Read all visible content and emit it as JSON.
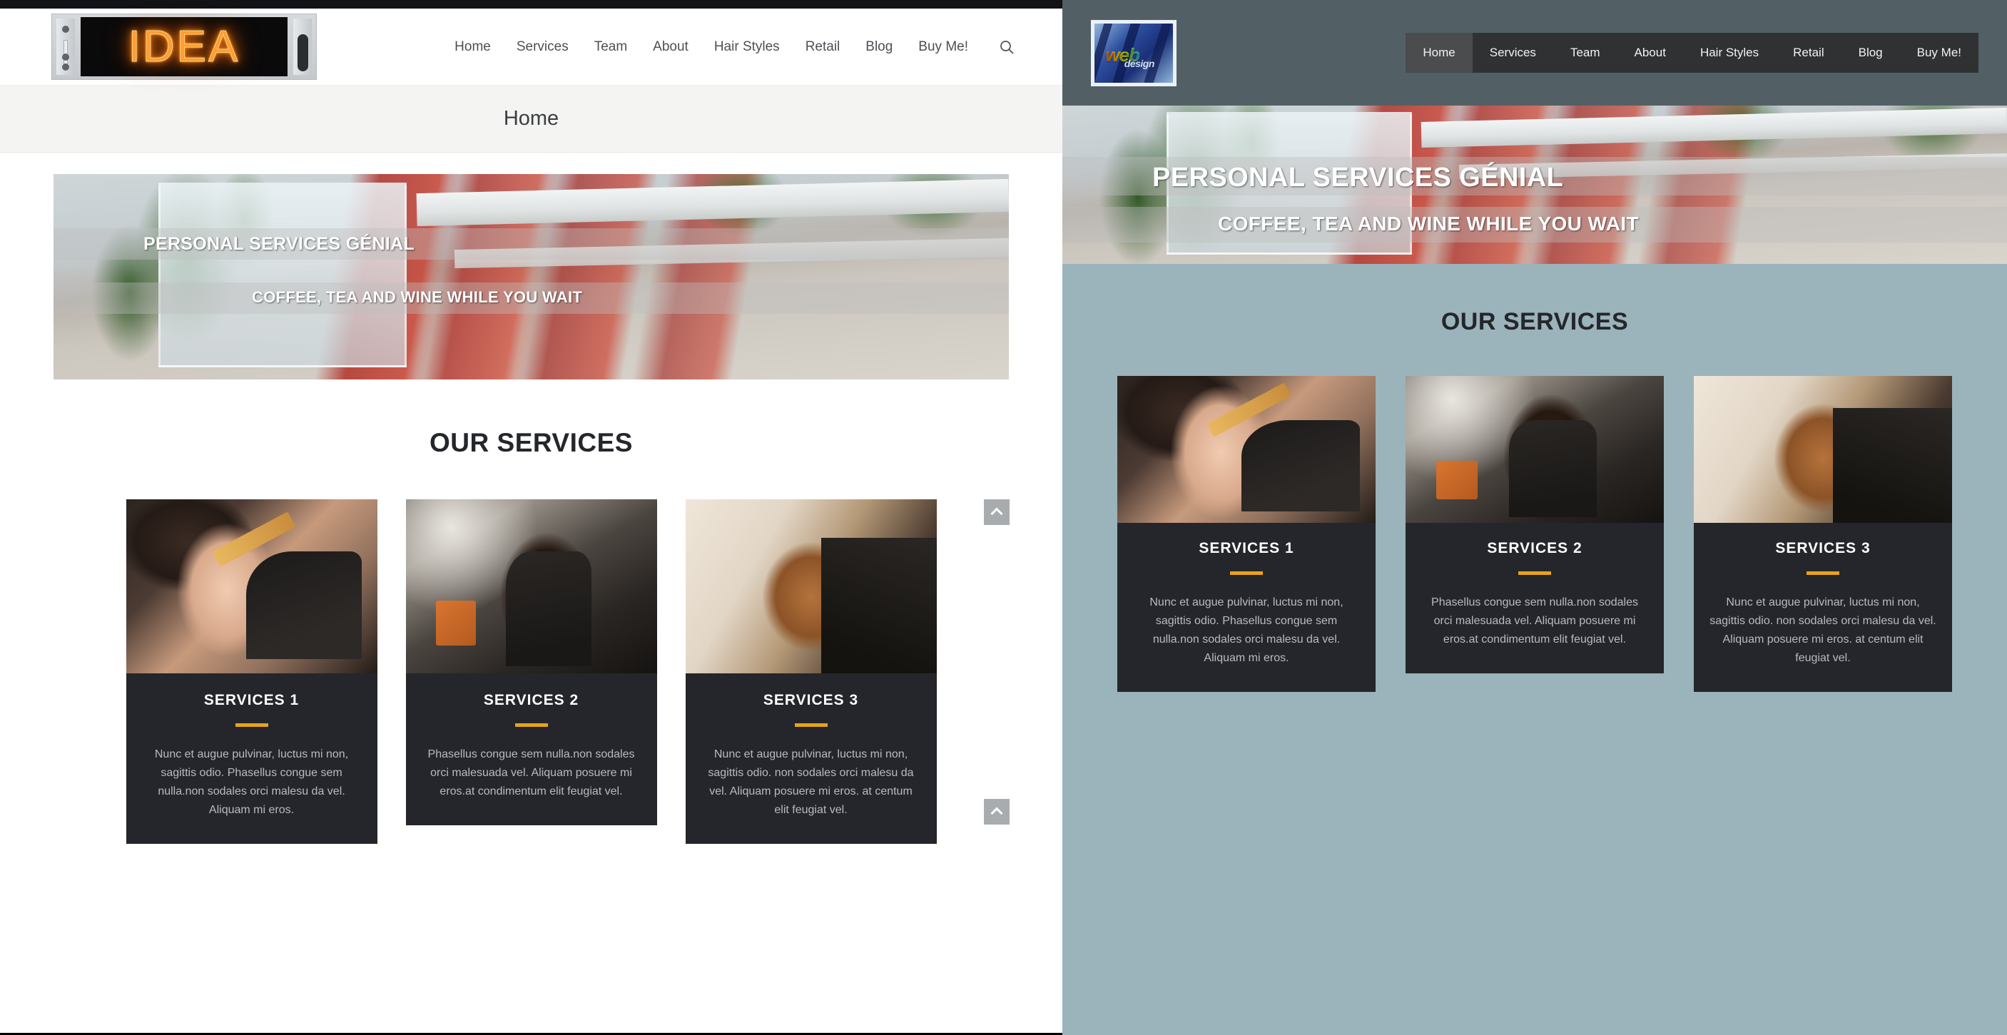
{
  "left_preview": {
    "top_strip_color": "#111317",
    "logo": {
      "name": "idea-neon-sign",
      "text": "IDEA",
      "glow_color": "#ff8a1a"
    },
    "nav": {
      "items": [
        {
          "label": "Home"
        },
        {
          "label": "Services"
        },
        {
          "label": "Team"
        },
        {
          "label": "About"
        },
        {
          "label": "Hair Styles"
        },
        {
          "label": "Retail"
        },
        {
          "label": "Blog"
        },
        {
          "label": "Buy Me!"
        }
      ],
      "search_icon": "search-icon"
    },
    "breadcrumb": {
      "text": "Home"
    },
    "hero": {
      "title": "PERSONAL SERVICES GÉNIAL",
      "subtitle": "COFFEE, TEA AND WINE WHILE YOU WAIT",
      "image_alt": "salon-interior-red-chairs"
    },
    "section": {
      "title": "OUR SERVICES"
    },
    "cards": [
      {
        "title": "SERVICES 1",
        "text": "Nunc et augue pulvinar, luctus mi non, sagittis odio. Phasellus congue sem nulla.non sodales orci malesu da vel. Aliquam mi eros.",
        "image_alt": "hairdresser-detail-braid"
      },
      {
        "title": "SERVICES 2",
        "text": "Phasellus congue sem nulla.non sodales orci malesuada vel. Aliquam posuere mi eros.at condimentum elit feugiat vel.",
        "image_alt": "stylist-blow-drying-hair"
      },
      {
        "title": "SERVICES 3",
        "text": "Nunc et augue pulvinar, luctus mi non, sagittis odio. non sodales orci malesu da vel. Aliquam posuere mi eros. at centum elit feugiat vel.",
        "image_alt": "updo-hairstyle-back-view"
      }
    ],
    "accent_color": "#e8a317",
    "card_bg_color": "#24262b",
    "scroll_top_buttons": [
      {
        "icon": "chevron-up-icon"
      },
      {
        "icon": "chevron-up-icon"
      }
    ]
  },
  "right_preview": {
    "header_bg_color": "#526065",
    "page_bg_color": "#9bb3bb",
    "logo": {
      "name": "web-design-logo",
      "text": "web",
      "subtext": "design"
    },
    "nav": {
      "bar_bg_color": "#2f3133",
      "active_bg_color": "#4a4c4e",
      "items": [
        {
          "label": "Home",
          "active": true
        },
        {
          "label": "Services",
          "active": false
        },
        {
          "label": "Team",
          "active": false
        },
        {
          "label": "About",
          "active": false
        },
        {
          "label": "Hair Styles",
          "active": false
        },
        {
          "label": "Retail",
          "active": false
        },
        {
          "label": "Blog",
          "active": false
        },
        {
          "label": "Buy Me!",
          "active": false
        }
      ]
    },
    "hero": {
      "title": "PERSONAL SERVICES GÉNIAL",
      "subtitle": "COFFEE, TEA AND WINE WHILE YOU WAIT",
      "image_alt": "salon-interior-red-chairs"
    },
    "section": {
      "title": "OUR SERVICES"
    },
    "cards": [
      {
        "title": "SERVICES 1",
        "text": "Nunc et augue pulvinar, luctus mi non, sagittis odio. Phasellus congue sem nulla.non sodales orci malesu da vel. Aliquam mi eros.",
        "image_alt": "hairdresser-detail-braid"
      },
      {
        "title": "SERVICES 2",
        "text": "Phasellus congue sem nulla.non sodales orci malesuada vel. Aliquam posuere mi eros.at condimentum elit feugiat vel.",
        "image_alt": "stylist-blow-drying-hair"
      },
      {
        "title": "SERVICES 3",
        "text": "Nunc et augue pulvinar, luctus mi non, sagittis odio. non sodales orci malesu da vel. Aliquam posuere mi eros. at centum elit feugiat vel.",
        "image_alt": "updo-hairstyle-back-view"
      }
    ]
  }
}
